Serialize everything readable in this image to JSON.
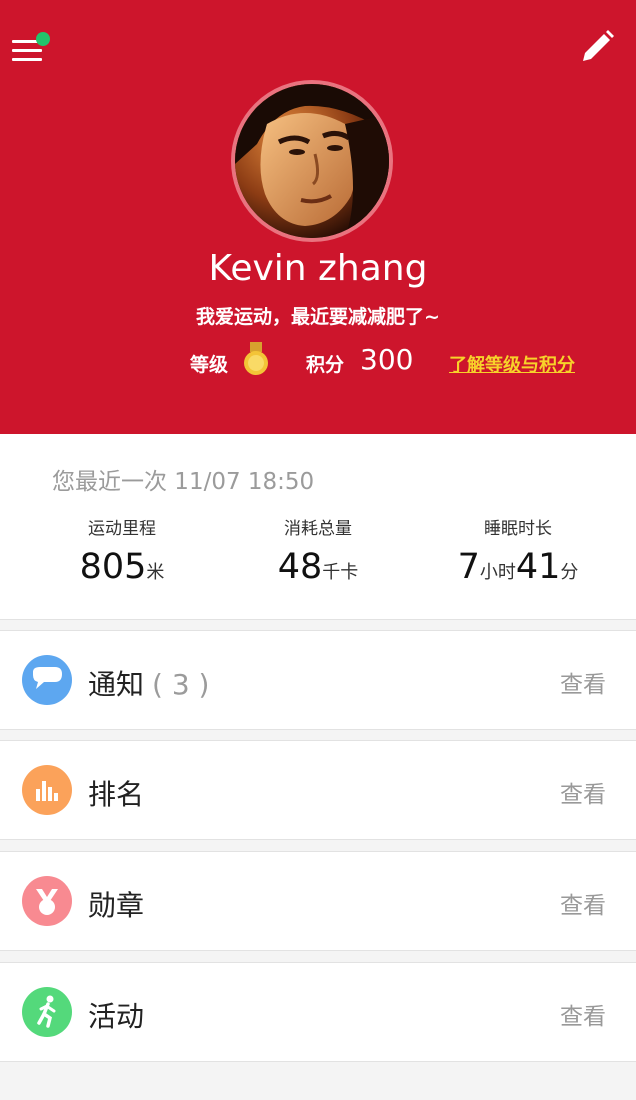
{
  "header": {
    "username": "Kevin zhang",
    "signature": "我爱运动，最近要减减肥了~",
    "level_label": "等级",
    "points_label": "积分",
    "points_value": "300",
    "level_link": "了解等级与积分",
    "brand_color": "#cd152c",
    "notification_dot_color": "#23c36b",
    "link_color": "#f7d22a"
  },
  "stats": {
    "recent": "您最近一次 11/07 18:50",
    "distance": {
      "label": "运动里程",
      "value": "805",
      "unit": "米"
    },
    "calories": {
      "label": "消耗总量",
      "value": "48",
      "unit": "千卡"
    },
    "sleep": {
      "label": "睡眠时长",
      "hours": "7",
      "hours_unit": "小时",
      "minutes": "41",
      "minutes_unit": "分"
    }
  },
  "menu": [
    {
      "label": "通知",
      "count": "( 3 )",
      "action": "查看",
      "icon": "chat-bubble-icon",
      "color": "#5da7f0"
    },
    {
      "label": "排名",
      "action": "查看",
      "icon": "bar-chart-icon",
      "color": "#fba25a"
    },
    {
      "label": "勋章",
      "action": "查看",
      "icon": "medal-icon",
      "color": "#f88a91"
    },
    {
      "label": "活动",
      "action": "查看",
      "icon": "runner-icon",
      "color": "#54d97b"
    }
  ]
}
